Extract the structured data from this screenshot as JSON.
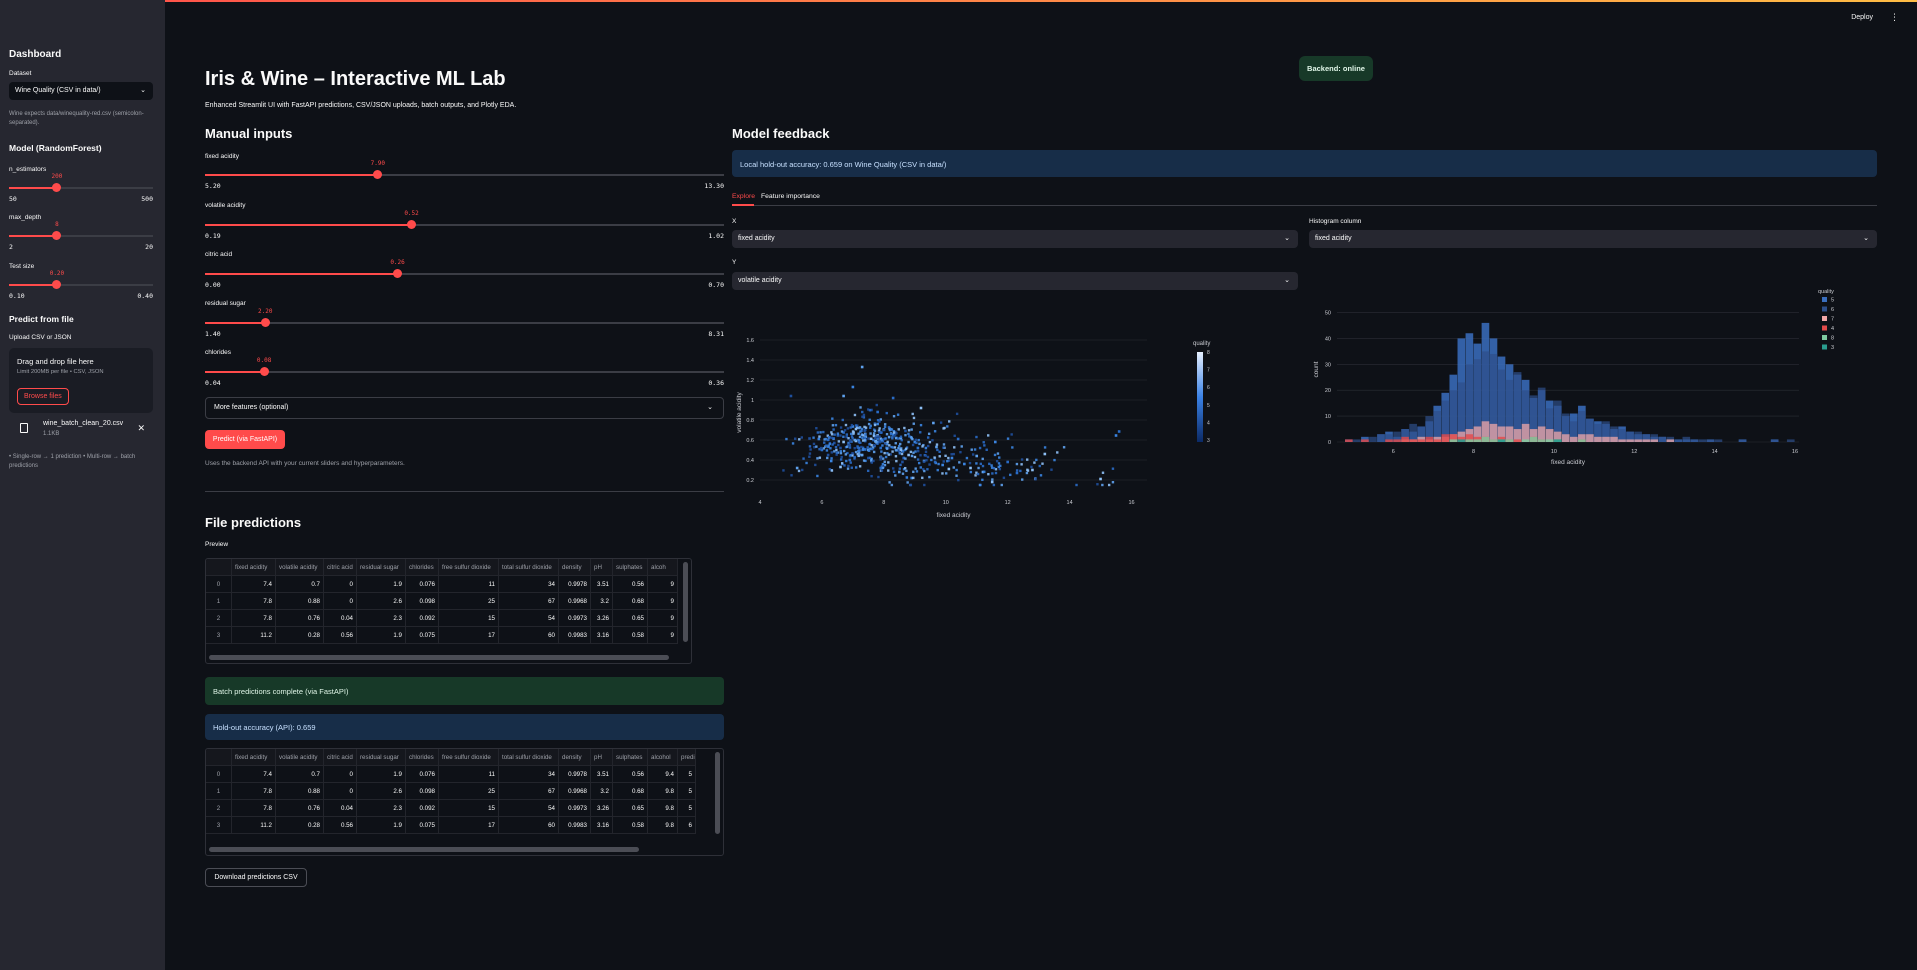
{
  "header": {
    "deploy": "Deploy",
    "menu_icon": "⋮"
  },
  "sidebar": {
    "title": "Dashboard",
    "dataset_label": "Dataset",
    "dataset_value": "Wine Quality (CSV in data/)",
    "dataset_caption": "Wine expects data/winequality-red.csv (semicolon-separated).",
    "model_heading": "Model (RandomForest)",
    "sliders": [
      {
        "label": "n_estimators",
        "value": "200",
        "min": "50",
        "max": "500",
        "frac": 0.333
      },
      {
        "label": "max_depth",
        "value": "8",
        "min": "2",
        "max": "20",
        "frac": 0.333
      },
      {
        "label": "Test size",
        "value": "0.20",
        "min": "0.10",
        "max": "0.40",
        "frac": 0.333
      }
    ],
    "predict_heading": "Predict from file",
    "upload_label": "Upload CSV or JSON",
    "dropzone_title": "Drag and drop file here",
    "dropzone_limit": "Limit 200MB per file • CSV, JSON",
    "browse_label": "Browse files",
    "file_name": "wine_batch_clean_20.csv",
    "file_size": "1.1KB",
    "note": "• Single-row → 1 prediction • Multi-row → batch predictions"
  },
  "status_badge": "Backend: online",
  "page_title": "Iris & Wine – Interactive ML Lab",
  "page_subtitle": "Enhanced Streamlit UI with FastAPI predictions, CSV/JSON uploads, batch outputs, and Plotly EDA.",
  "manual": {
    "heading": "Manual inputs",
    "sliders": [
      {
        "label": "fixed acidity",
        "value": "7.90",
        "min": "5.20",
        "max": "13.30",
        "frac": 0.333
      },
      {
        "label": "volatile acidity",
        "value": "0.52",
        "min": "0.19",
        "max": "1.02",
        "frac": 0.398
      },
      {
        "label": "citric acid",
        "value": "0.26",
        "min": "0.00",
        "max": "0.70",
        "frac": 0.371
      },
      {
        "label": "residual sugar",
        "value": "2.20",
        "min": "1.40",
        "max": "8.31",
        "frac": 0.116
      },
      {
        "label": "chlorides",
        "value": "0.08",
        "min": "0.04",
        "max": "0.36",
        "frac": 0.114
      }
    ],
    "more_features": "More features (optional)",
    "predict_button": "Predict (via FastAPI)",
    "predict_caption": "Uses the backend API with your current sliders and hyperparameters."
  },
  "file_predictions": {
    "heading": "File predictions",
    "preview_label": "Preview",
    "columns": [
      "",
      "fixed acidity",
      "volatile acidity",
      "citric acid",
      "residual sugar",
      "chlorides",
      "free sulfur dioxide",
      "total sulfur dioxide",
      "density",
      "pH",
      "sulphates",
      "alcoh"
    ],
    "rows": [
      [
        "0",
        "7.4",
        "0.7",
        "0",
        "1.9",
        "0.076",
        "11",
        "34",
        "0.9978",
        "3.51",
        "0.56",
        "9"
      ],
      [
        "1",
        "7.8",
        "0.88",
        "0",
        "2.6",
        "0.098",
        "25",
        "67",
        "0.9968",
        "3.2",
        "0.68",
        "9"
      ],
      [
        "2",
        "7.8",
        "0.76",
        "0.04",
        "2.3",
        "0.092",
        "15",
        "54",
        "0.9973",
        "3.26",
        "0.65",
        "9"
      ],
      [
        "3",
        "11.2",
        "0.28",
        "0.56",
        "1.9",
        "0.075",
        "17",
        "60",
        "0.9983",
        "3.16",
        "0.58",
        "9"
      ]
    ],
    "batch_success": "Batch predictions complete (via FastAPI)",
    "holdout_api": "Hold-out accuracy (API): 0.659",
    "result_columns": [
      "",
      "fixed acidity",
      "volatile acidity",
      "citric acid",
      "residual sugar",
      "chlorides",
      "free sulfur dioxide",
      "total sulfur dioxide",
      "density",
      "pH",
      "sulphates",
      "alcohol",
      "predi"
    ],
    "result_rows": [
      [
        "0",
        "7.4",
        "0.7",
        "0",
        "1.9",
        "0.076",
        "11",
        "34",
        "0.9978",
        "3.51",
        "0.56",
        "9.4",
        "5"
      ],
      [
        "1",
        "7.8",
        "0.88",
        "0",
        "2.6",
        "0.098",
        "25",
        "67",
        "0.9968",
        "3.2",
        "0.68",
        "9.8",
        "5"
      ],
      [
        "2",
        "7.8",
        "0.76",
        "0.04",
        "2.3",
        "0.092",
        "15",
        "54",
        "0.9973",
        "3.26",
        "0.65",
        "9.8",
        "5"
      ],
      [
        "3",
        "11.2",
        "0.28",
        "0.56",
        "1.9",
        "0.075",
        "17",
        "60",
        "0.9983",
        "3.16",
        "0.58",
        "9.8",
        "6"
      ]
    ],
    "download_button": "Download predictions CSV"
  },
  "feedback": {
    "heading": "Model feedback",
    "local_accuracy": "Local hold-out accuracy: 0.659 on Wine Quality (CSV in data/)",
    "tabs": [
      "Explore",
      "Feature importance"
    ],
    "x_label": "X",
    "x_value": "fixed acidity",
    "y_label": "Y",
    "y_value": "volatile acidity",
    "hist_label": "Histogram column",
    "hist_value": "fixed acidity"
  },
  "colors": {
    "accent": "#ff4b4b",
    "bg": "#0e1117",
    "sidebar": "#262730"
  },
  "chart_data": [
    {
      "type": "scatter",
      "xlabel": "fixed acidity",
      "ylabel": "volatile acidity",
      "colorbar_title": "quality",
      "colorbar_ticks": [
        "8",
        "7",
        "6",
        "5",
        "4",
        "3"
      ],
      "xlim": [
        4,
        16.5
      ],
      "ylim": [
        0.1,
        1.65
      ],
      "xticks": [
        4,
        6,
        8,
        10,
        12,
        14,
        16
      ],
      "yticks": [
        0.2,
        0.4,
        0.6,
        0.8,
        1,
        1.2,
        1.4,
        1.6
      ],
      "points": [
        [
          7.4,
          0.7
        ],
        [
          7.8,
          0.88
        ],
        [
          7.8,
          0.76
        ],
        [
          11.2,
          0.28
        ],
        [
          7.4,
          0.66
        ],
        [
          7.9,
          0.6
        ],
        [
          7.3,
          0.65
        ],
        [
          7.8,
          0.58
        ],
        [
          7.5,
          0.5
        ],
        [
          6.7,
          0.58
        ],
        [
          5.6,
          0.615
        ],
        [
          7.8,
          0.61
        ],
        [
          8.9,
          0.62
        ],
        [
          8.5,
          0.28
        ],
        [
          8.1,
          0.56
        ],
        [
          7.4,
          0.59
        ],
        [
          7.9,
          0.32
        ],
        [
          8.9,
          0.22
        ],
        [
          7.6,
          0.39
        ],
        [
          7.9,
          0.43
        ],
        [
          8.5,
          0.49
        ],
        [
          6.9,
          0.4
        ],
        [
          6.3,
          0.39
        ],
        [
          7.6,
          0.41
        ],
        [
          7.1,
          0.71
        ],
        [
          7.8,
          0.645
        ],
        [
          6.7,
          0.675
        ],
        [
          8.3,
          0.655
        ],
        [
          5.2,
          0.32
        ],
        [
          7.8,
          0.645
        ],
        [
          8.6,
          0.38
        ],
        [
          7.9,
          0.52
        ],
        [
          10.2,
          0.42
        ],
        [
          9.6,
          0.77
        ],
        [
          12.8,
          0.3
        ],
        [
          6.2,
          0.45
        ],
        [
          10.4,
          0.61
        ],
        [
          11.6,
          0.58
        ],
        [
          9.3,
          0.39
        ],
        [
          8.8,
          0.45
        ],
        [
          6.8,
          0.63
        ],
        [
          9.1,
          0.52
        ],
        [
          8.2,
          0.7
        ],
        [
          7.3,
          0.45
        ],
        [
          10.1,
          0.31
        ],
        [
          6.4,
          0.57
        ],
        [
          12.3,
          0.27
        ],
        [
          7.0,
          0.735
        ],
        [
          8.6,
          0.49
        ],
        [
          15.0,
          0.21
        ],
        [
          6.6,
          0.52
        ],
        [
          7.7,
          0.54
        ],
        [
          9.9,
          0.35
        ],
        [
          8.0,
          0.705
        ],
        [
          11.5,
          0.18
        ],
        [
          6.9,
          0.55
        ],
        [
          7.2,
          0.52
        ],
        [
          10.6,
          0.36
        ],
        [
          8.4,
          0.62
        ],
        [
          13.2,
          0.46
        ],
        [
          7.5,
          0.42
        ],
        [
          6.0,
          0.5
        ],
        [
          9.0,
          0.58
        ],
        [
          11.0,
          0.44
        ],
        [
          7.1,
          0.59
        ],
        [
          8.7,
          0.69
        ],
        [
          12.0,
          0.38
        ],
        [
          5.9,
          0.61
        ],
        [
          9.7,
          0.53
        ],
        [
          10.8,
          0.32
        ],
        [
          7.6,
          0.9
        ],
        [
          8.3,
          1.02
        ],
        [
          7.0,
          1.13
        ],
        [
          6.7,
          1.04
        ],
        [
          9.2,
          0.92
        ],
        [
          5.0,
          1.04
        ],
        [
          15.6,
          0.685
        ],
        [
          15.5,
          0.645
        ],
        [
          7.3,
          1.33
        ],
        [
          6.6,
          0.33
        ]
      ]
    },
    {
      "type": "bar",
      "xlabel": "fixed acidity",
      "ylabel": "count",
      "legend_title": "quality",
      "legend": [
        "5",
        "6",
        "7",
        "4",
        "8",
        "3"
      ],
      "xlim": [
        4.6,
        16.1
      ],
      "ylim": [
        0,
        56
      ],
      "xticks": [
        6,
        8,
        10,
        12,
        14,
        16
      ],
      "yticks": [
        0,
        10,
        20,
        30,
        40,
        50
      ],
      "bin_start": 4.6,
      "bin_width": 0.2,
      "series": [
        {
          "name": "5",
          "values": [
            0,
            1,
            0,
            2,
            0,
            3,
            4,
            2,
            5,
            4,
            6,
            8,
            14,
            19,
            26,
            40,
            42,
            38,
            46,
            40,
            33,
            30,
            26,
            24,
            17,
            20,
            16,
            14,
            10,
            11,
            14,
            9,
            8,
            7,
            5,
            6,
            4,
            3,
            3,
            2,
            2,
            1,
            1,
            1,
            1,
            0,
            1,
            0,
            0,
            0,
            1,
            0,
            0,
            0,
            1,
            0,
            0,
            0
          ]
        },
        {
          "name": "6",
          "values": [
            0,
            1,
            1,
            1,
            2,
            3,
            3,
            4,
            5,
            7,
            6,
            10,
            12,
            16,
            20,
            23,
            30,
            32,
            35,
            34,
            28,
            24,
            27,
            20,
            18,
            21,
            13,
            16,
            11,
            8,
            12,
            9,
            7,
            8,
            6,
            5,
            4,
            4,
            3,
            3,
            2,
            2,
            1,
            2,
            1,
            1,
            1,
            1,
            0,
            0,
            1,
            0,
            0,
            0,
            1,
            0,
            1,
            0
          ]
        },
        {
          "name": "7",
          "values": [
            0,
            0,
            0,
            0,
            0,
            0,
            0,
            0,
            1,
            1,
            2,
            1,
            2,
            2,
            3,
            4,
            5,
            6,
            8,
            7,
            6,
            6,
            5,
            7,
            5,
            6,
            5,
            4,
            3,
            2,
            3,
            3,
            2,
            2,
            2,
            1,
            1,
            1,
            1,
            1,
            0,
            1,
            0,
            0,
            0,
            0,
            0,
            0,
            0,
            0,
            0,
            0,
            0,
            0,
            0,
            0,
            0,
            0
          ]
        },
        {
          "name": "4",
          "values": [
            0,
            1,
            0,
            1,
            0,
            0,
            1,
            1,
            2,
            1,
            1,
            2,
            1,
            3,
            3,
            2,
            3,
            2,
            2,
            1,
            2,
            1,
            1,
            0,
            2,
            1,
            0,
            1,
            0,
            0,
            1,
            0,
            0,
            0,
            0,
            0,
            0,
            0,
            0,
            0,
            0,
            0,
            0,
            0,
            0,
            0,
            0,
            0,
            0,
            0,
            0,
            0,
            0,
            0,
            0,
            0,
            0,
            0
          ]
        },
        {
          "name": "8",
          "values": [
            0,
            0,
            0,
            0,
            0,
            0,
            0,
            0,
            0,
            0,
            0,
            0,
            0,
            0,
            1,
            0,
            1,
            1,
            2,
            1,
            1,
            1,
            0,
            1,
            2,
            1,
            1,
            1,
            0,
            0,
            1,
            0,
            0,
            0,
            0,
            0,
            0,
            0,
            0,
            0,
            0,
            0,
            0,
            0,
            0,
            0,
            0,
            0,
            0,
            0,
            0,
            0,
            0,
            0,
            0,
            0,
            0,
            0
          ]
        },
        {
          "name": "3",
          "values": [
            0,
            0,
            0,
            0,
            0,
            0,
            0,
            0,
            0,
            0,
            0,
            0,
            0,
            0,
            0,
            1,
            0,
            0,
            0,
            0,
            1,
            0,
            0,
            0,
            0,
            0,
            0,
            1,
            0,
            0,
            0,
            0,
            0,
            0,
            0,
            0,
            0,
            0,
            0,
            0,
            0,
            0,
            0,
            0,
            0,
            0,
            0,
            0,
            0,
            0,
            0,
            0,
            0,
            0,
            0,
            0,
            0,
            0
          ]
        }
      ]
    }
  ]
}
